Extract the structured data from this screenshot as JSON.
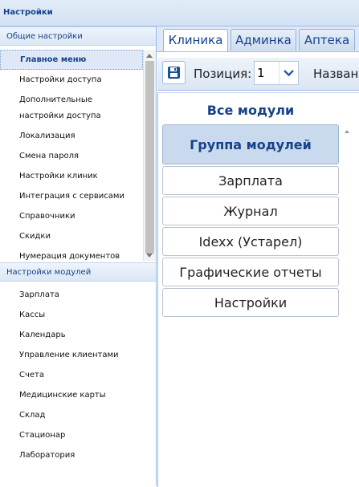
{
  "window": {
    "title": "Настройки"
  },
  "left_panel": {
    "general_section": {
      "header": "Общие настройки",
      "items": [
        {
          "label": "Главное меню",
          "selected": true
        },
        {
          "label": "Настройки доступа"
        },
        {
          "label": "Дополнительные настройки доступа"
        },
        {
          "label": "Локализация"
        },
        {
          "label": "Смена пароля"
        },
        {
          "label": "Настройки клиник"
        },
        {
          "label": "Интеграция с сервисами"
        },
        {
          "label": "Справочники"
        },
        {
          "label": "Скидки"
        },
        {
          "label": "Нумерация документов"
        }
      ]
    },
    "modules_section": {
      "header": "Настройки модулей",
      "items": [
        {
          "label": "Зарплата"
        },
        {
          "label": "Кассы"
        },
        {
          "label": "Календарь"
        },
        {
          "label": "Управление клиентами"
        },
        {
          "label": "Счета"
        },
        {
          "label": "Медицинские карты"
        },
        {
          "label": "Склад"
        },
        {
          "label": "Стационар"
        },
        {
          "label": "Лаборатория"
        }
      ]
    }
  },
  "tabs": [
    {
      "label": "Клиника",
      "active": true
    },
    {
      "label": "Админка"
    },
    {
      "label": "Аптека"
    }
  ],
  "toolbar": {
    "save_icon": "save-icon",
    "position_label": "Позиция:",
    "position_value": "1",
    "name_label": "Названи"
  },
  "modules_panel": {
    "title": "Все модули",
    "items": [
      {
        "label": "Группа модулей",
        "type": "group"
      },
      {
        "label": "Зарплата"
      },
      {
        "label": "Журнал"
      },
      {
        "label": "Idexx (Устарел)"
      },
      {
        "label": "Графические отчеты"
      },
      {
        "label": "Настройки"
      }
    ]
  },
  "colors": {
    "accent": "#15428b",
    "border": "#99bbe8",
    "selected_bg": "#dfe8f6"
  }
}
